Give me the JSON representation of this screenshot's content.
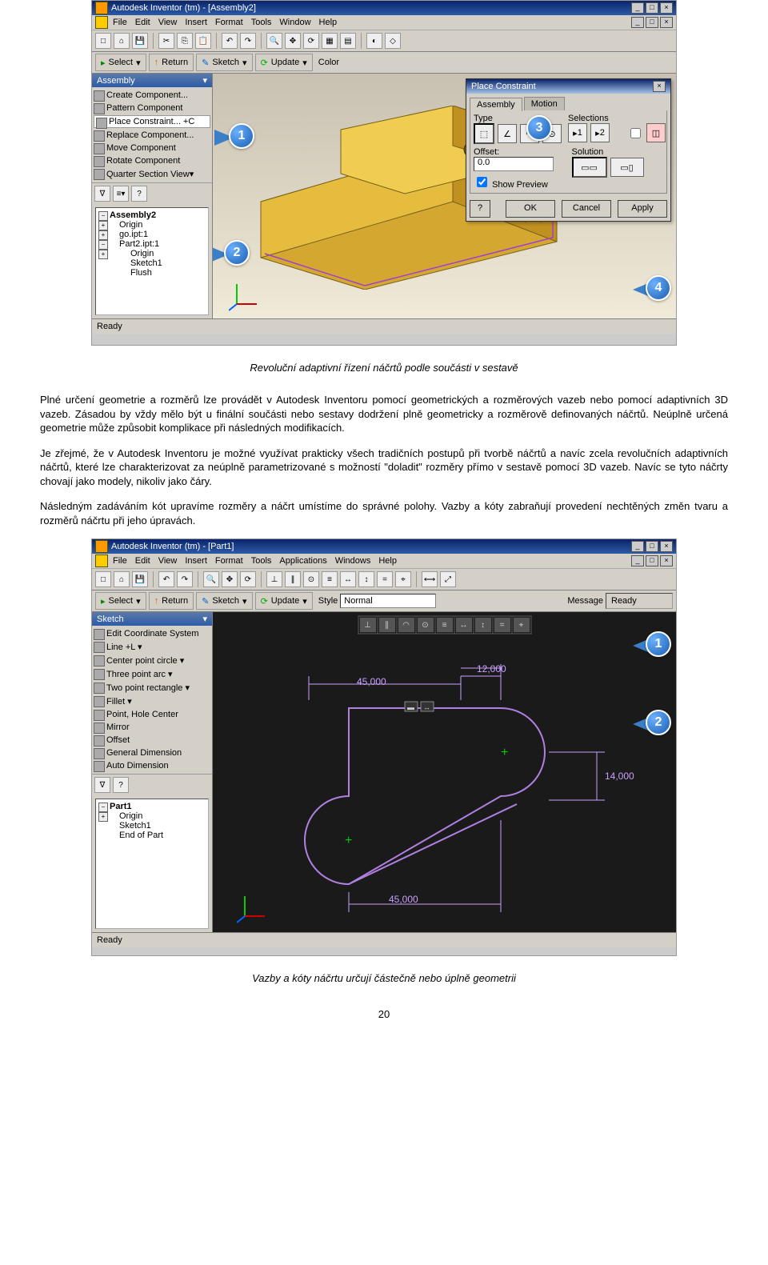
{
  "fig1": {
    "title": "Autodesk Inventor (tm) - [Assembly2]",
    "menu": [
      "File",
      "Edit",
      "View",
      "Insert",
      "Format",
      "Tools",
      "Window",
      "Help"
    ],
    "toolbar2": {
      "select": "Select",
      "return": "Return",
      "sketch": "Sketch",
      "update": "Update",
      "color_label": "Color"
    },
    "panel_header": "Assembly",
    "panel_items": [
      "Create Component...",
      "Pattern Component",
      "Place Constraint... +C",
      "Replace Component... ",
      "Move Component",
      "Rotate Component",
      "Quarter Section View"
    ],
    "tree": {
      "root": "Assembly2",
      "items": [
        "Origin",
        "go.ipt:1",
        "Part2.ipt:1"
      ],
      "sub": [
        "Origin",
        "Sketch1",
        "Flush"
      ]
    },
    "dialog": {
      "title": "Place Constraint",
      "tabs": [
        "Assembly",
        "Motion"
      ],
      "type_label": "Type",
      "selections_label": "Selections",
      "sel1": "1",
      "sel2": "2",
      "offset_label": "Offset:",
      "offset_value": "0.0",
      "solution_label": "Solution",
      "show_preview": "Show Preview",
      "ok": "OK",
      "cancel": "Cancel",
      "apply": "Apply"
    },
    "callouts": [
      "1",
      "2",
      "3",
      "4"
    ],
    "status": "Ready"
  },
  "caption1": "Revoluční adaptivní řízení náčrtů podle součásti v sestavě",
  "para1": "Plné určení geometrie a rozměrů lze provádět v Autodesk Inventoru pomocí geometrických a rozměrových vazeb nebo pomocí adaptivních 3D vazeb. Zásadou by vždy mělo být u finální součásti nebo sestavy dodržení plně geometricky a rozměrově definovaných náčrtů. Neúplně určená geometrie může způsobit komplikace při následných modifikacích.",
  "para2": "Je zřejmé, že v Autodesk Inventoru je možné využívat prakticky všech tradičních postupů při tvorbě náčrtů a navíc zcela revolučních adaptivních náčrtů, které lze charakterizovat za neúplně parametrizované s možností \"doladit\" rozměry přímo v sestavě pomocí 3D vazeb. Navíc se tyto náčrty chovají jako modely, nikoliv jako čáry.",
  "para3": "Následným zadáváním kót upravíme rozměry a náčrt umístíme do správné polohy. Vazby a kóty zabraňují provedení nechtěných změn tvaru a rozměrů náčrtu při jeho úpravách.",
  "fig2": {
    "title": "Autodesk Inventor (tm) - [Part1]",
    "menu": [
      "File",
      "Edit",
      "View",
      "Insert",
      "Format",
      "Tools",
      "Applications",
      "Windows",
      "Help"
    ],
    "toolbar2": {
      "select": "Select",
      "return": "Return",
      "sketch": "Sketch",
      "update": "Update",
      "style_label": "Style",
      "style_value": "Normal",
      "message_label": "Message",
      "ready": "Ready"
    },
    "panel_header": "Sketch",
    "panel_items": [
      "Edit Coordinate System",
      "Line   +L",
      "Center point circle",
      "Three point arc",
      "Two point rectangle",
      "Fillet",
      "Point, Hole Center",
      "Mirror",
      "Offset",
      "General Dimension",
      "Auto Dimension"
    ],
    "tree": {
      "root": "Part1",
      "items": [
        "Origin",
        "Sketch1",
        "End of Part"
      ]
    },
    "dims": {
      "d1": "45,000",
      "d2": "12,000",
      "d3": "14,000",
      "d4": "45,000"
    },
    "callouts": [
      "1",
      "2"
    ],
    "status": "Ready"
  },
  "caption2": "Vazby a kóty náčrtu určují částečně nebo úplně geometrii",
  "pagenum": "20"
}
